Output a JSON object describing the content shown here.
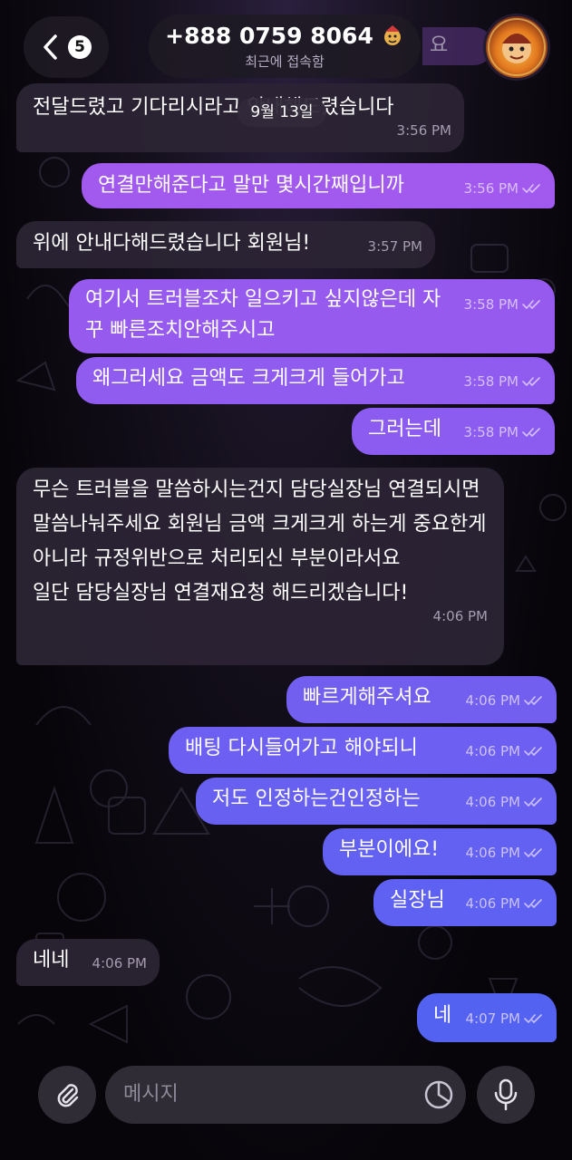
{
  "header": {
    "back_badge": "5",
    "contact_name": "+888 0759 8064",
    "status": "최근에 접속함",
    "ghost_text": "요"
  },
  "date_chip": "9월 13일",
  "messages": [
    {
      "dir": "in",
      "text": "전달드렸고 기다리시라고 안내해드렸습니다",
      "time": "3:56 PM"
    },
    {
      "dir": "out",
      "text": "연결만해준다고 말만 몇시간째입니까",
      "time": "3:56 PM"
    },
    {
      "dir": "in",
      "text": "위에 안내다해드렸습니다 회원님!",
      "time": "3:57 PM"
    },
    {
      "dir": "out",
      "text": "여기서 트러블조차 일으키고 싶지않은데 자꾸 빠른조치안해주시고",
      "time": "3:58 PM"
    },
    {
      "dir": "out",
      "text": "왜그러세요 금액도 크게크게 들어가고",
      "time": "3:58 PM"
    },
    {
      "dir": "out",
      "text": "그러는데",
      "time": "3:58 PM"
    },
    {
      "dir": "in",
      "text": "무슨 트러블을 말씀하시는건지 담당실장님 연결되시면 말씀나눠주세요 회원님 금액 크게크게 하는게 중요한게 아니라 규정위반으로 처리되신 부분이라서요\n일단 담당실장님 연결재요청 해드리겠습니다!",
      "time": "4:06 PM"
    },
    {
      "dir": "out",
      "text": "빠르게해주셔요",
      "time": "4:06 PM"
    },
    {
      "dir": "out",
      "text": "배팅 다시들어가고 해야되니",
      "time": "4:06 PM"
    },
    {
      "dir": "out",
      "text": "저도 인정하는건인정하는",
      "time": "4:06 PM"
    },
    {
      "dir": "out",
      "text": "부분이에요!",
      "time": "4:06 PM"
    },
    {
      "dir": "out",
      "text": "실장님",
      "time": "4:06 PM"
    },
    {
      "dir": "in",
      "text": "네네",
      "time": "4:06 PM"
    },
    {
      "dir": "out",
      "text": "네",
      "time": "4:07 PM"
    }
  ],
  "input": {
    "placeholder": "메시지"
  },
  "icons": {
    "back": "chevron-left-icon",
    "attach": "paperclip-icon",
    "sticker": "sticker-icon",
    "mic": "microphone-icon",
    "read": "double-check-icon",
    "avatar": "avatar-image"
  },
  "colors": {
    "incoming_bubble": "#2c2434",
    "outgoing_top": "#a259ee",
    "outgoing_bottom": "#4f63f2"
  }
}
